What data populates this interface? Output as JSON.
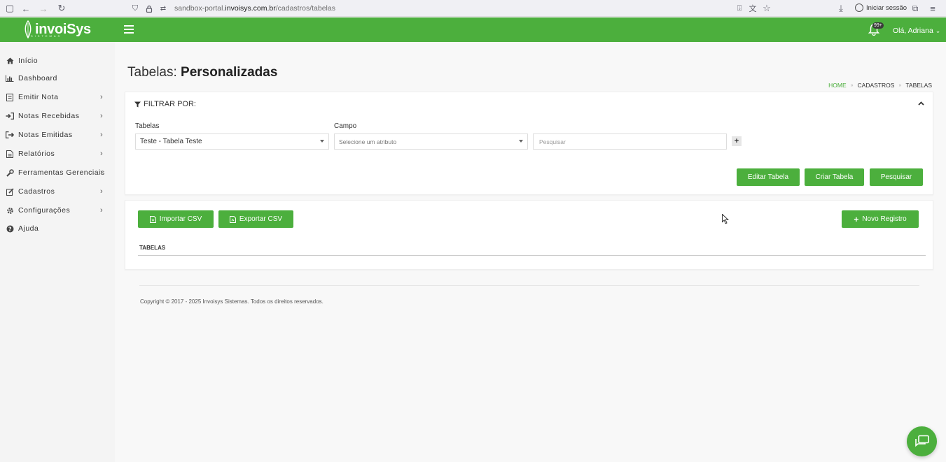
{
  "browser": {
    "url_prefix": "sandbox-portal.",
    "url_domain": "invoisys.com.br",
    "url_path": "/cadastros/tabelas",
    "signin_label": "Iniciar sessão"
  },
  "header": {
    "logo_text": "invoiSys",
    "logo_sub": "SISTEMAS",
    "notification_count": "99+",
    "greeting": "Olá, Adriana"
  },
  "sidebar": {
    "items": [
      {
        "label": "Início"
      },
      {
        "label": "Dashboard"
      },
      {
        "label": "Emitir Nota"
      },
      {
        "label": "Notas Recebidas"
      },
      {
        "label": "Notas Emitidas"
      },
      {
        "label": "Relatórios"
      },
      {
        "label": "Ferramentas Gerenciais"
      },
      {
        "label": "Cadastros"
      },
      {
        "label": "Configurações"
      },
      {
        "label": "Ajuda"
      }
    ]
  },
  "page": {
    "title_prefix": "Tabelas: ",
    "title_bold": "Personalizadas",
    "breadcrumb": [
      "HOME",
      "CADASTROS",
      "TABELAS"
    ]
  },
  "filter": {
    "title": "FILTRAR POR:",
    "tabelas_label": "Tabelas",
    "tabelas_value": "Teste - Tabela Teste",
    "campo_label": "Campo",
    "campo_placeholder": "Selecione um atributo",
    "search_placeholder": "Pesquisar",
    "buttons": {
      "edit": "Editar Tabela",
      "create": "Criar Tabela",
      "search": "Pesquisar"
    }
  },
  "records": {
    "import": "Importar CSV",
    "export": "Exportar CSV",
    "new": "Novo Registro",
    "column_header": "TABELAS"
  },
  "footer": {
    "text": "Copyright © 2017 - 2025 Invoisys Sistemas. Todos os direitos reservados."
  },
  "colors": {
    "brand_green": "#4caf3d"
  }
}
